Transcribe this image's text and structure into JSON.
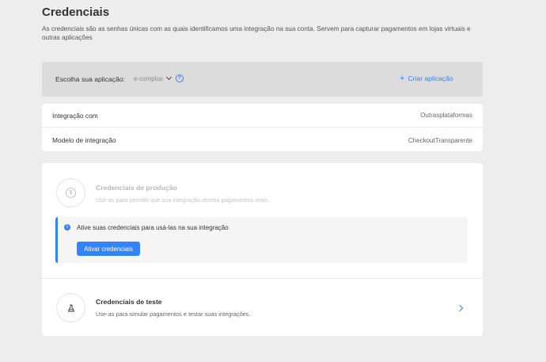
{
  "header": {
    "title": "Credenciais",
    "description": "As credenciais são as senhas únicas com as quais identificamos uma integração na sua conta. Servem para capturar pagamentos em lojas virtuais e outras aplicações"
  },
  "app_selector": {
    "label": "Escolha sua aplicação:",
    "selected": "e-complus",
    "help_icon": "question-circle-icon",
    "create_label": "Criar aplicação"
  },
  "integration_info": {
    "rows": [
      {
        "key": "Integração com",
        "value": "Outrasplataformas"
      },
      {
        "key": "Modelo de integração",
        "value": "CheckoutTransparente"
      }
    ]
  },
  "production": {
    "title": "Credenciais de produção",
    "subtitle": "Use-as para permitir que sua integração receba pagamentos reais.",
    "notice": "Ative suas credenciais para usá-las na sua integração",
    "activate_label": "Ativar credenciais",
    "icon": "dollar-coin-icon"
  },
  "test": {
    "title": "Credenciais de teste",
    "subtitle": "Use-as para simular pagamentos e testar suas integrações.",
    "icon": "flask-icon"
  },
  "colors": {
    "accent": "#3483fa",
    "background": "#ededed"
  }
}
